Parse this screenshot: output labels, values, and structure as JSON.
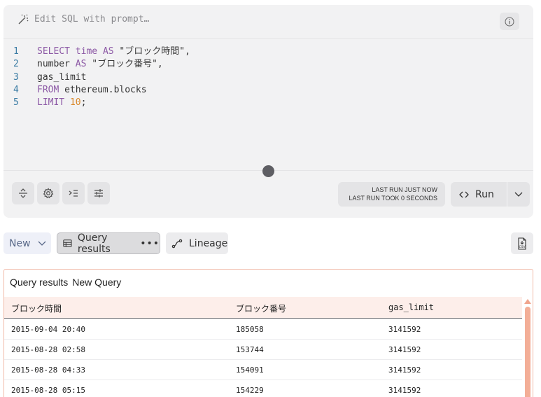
{
  "prompt_bar": {
    "placeholder": "Edit SQL with prompt…"
  },
  "code_lines": [
    {
      "num": "1",
      "tokens": [
        {
          "t": "SELECT",
          "k": "kw"
        },
        {
          "t": " ",
          "k": "plain"
        },
        {
          "t": "time",
          "k": "kw"
        },
        {
          "t": " ",
          "k": "plain"
        },
        {
          "t": "AS",
          "k": "kw"
        },
        {
          "t": " \"ブロック時間\",",
          "k": "str"
        }
      ]
    },
    {
      "num": "2",
      "tokens": [
        {
          "t": "number",
          "k": "plain"
        },
        {
          "t": " ",
          "k": "plain"
        },
        {
          "t": "AS",
          "k": "kw"
        },
        {
          "t": " \"ブロック番号\",",
          "k": "str"
        }
      ]
    },
    {
      "num": "3",
      "tokens": [
        {
          "t": "gas_limit",
          "k": "plain"
        }
      ]
    },
    {
      "num": "4",
      "tokens": [
        {
          "t": "FROM",
          "k": "kw"
        },
        {
          "t": " ethereum.blocks",
          "k": "plain"
        }
      ]
    },
    {
      "num": "5",
      "tokens": [
        {
          "t": "LIMIT",
          "k": "kw"
        },
        {
          "t": " ",
          "k": "plain"
        },
        {
          "t": "10",
          "k": "num"
        },
        {
          "t": ";",
          "k": "plain"
        }
      ]
    }
  ],
  "last_run": {
    "line1": "LAST RUN JUST NOW",
    "line2": "LAST RUN TOOK 0 SECONDS"
  },
  "run_button": {
    "label": "Run"
  },
  "tabs": {
    "new_label": "New",
    "query_results_label": "Query results",
    "more": "•••",
    "lineage_label": "Lineage"
  },
  "results": {
    "title": "Query results",
    "query_name": "New Query",
    "columns": [
      "ブロック時間",
      "ブロック番号",
      "gas_limit"
    ],
    "rows": [
      [
        "2015-09-04 20:40",
        "185058",
        "3141592"
      ],
      [
        "2015-08-28 02:58",
        "153744",
        "3141592"
      ],
      [
        "2015-08-28 04:33",
        "154091",
        "3141592"
      ],
      [
        "2015-08-28 05:15",
        "154229",
        "3141592"
      ]
    ]
  },
  "colors": {
    "accent_border": "#f0b9a8",
    "header_bg": "#fdeeea",
    "keyword": "#8d5aa6",
    "number": "#d98829",
    "line_number": "#3b7ca4"
  }
}
